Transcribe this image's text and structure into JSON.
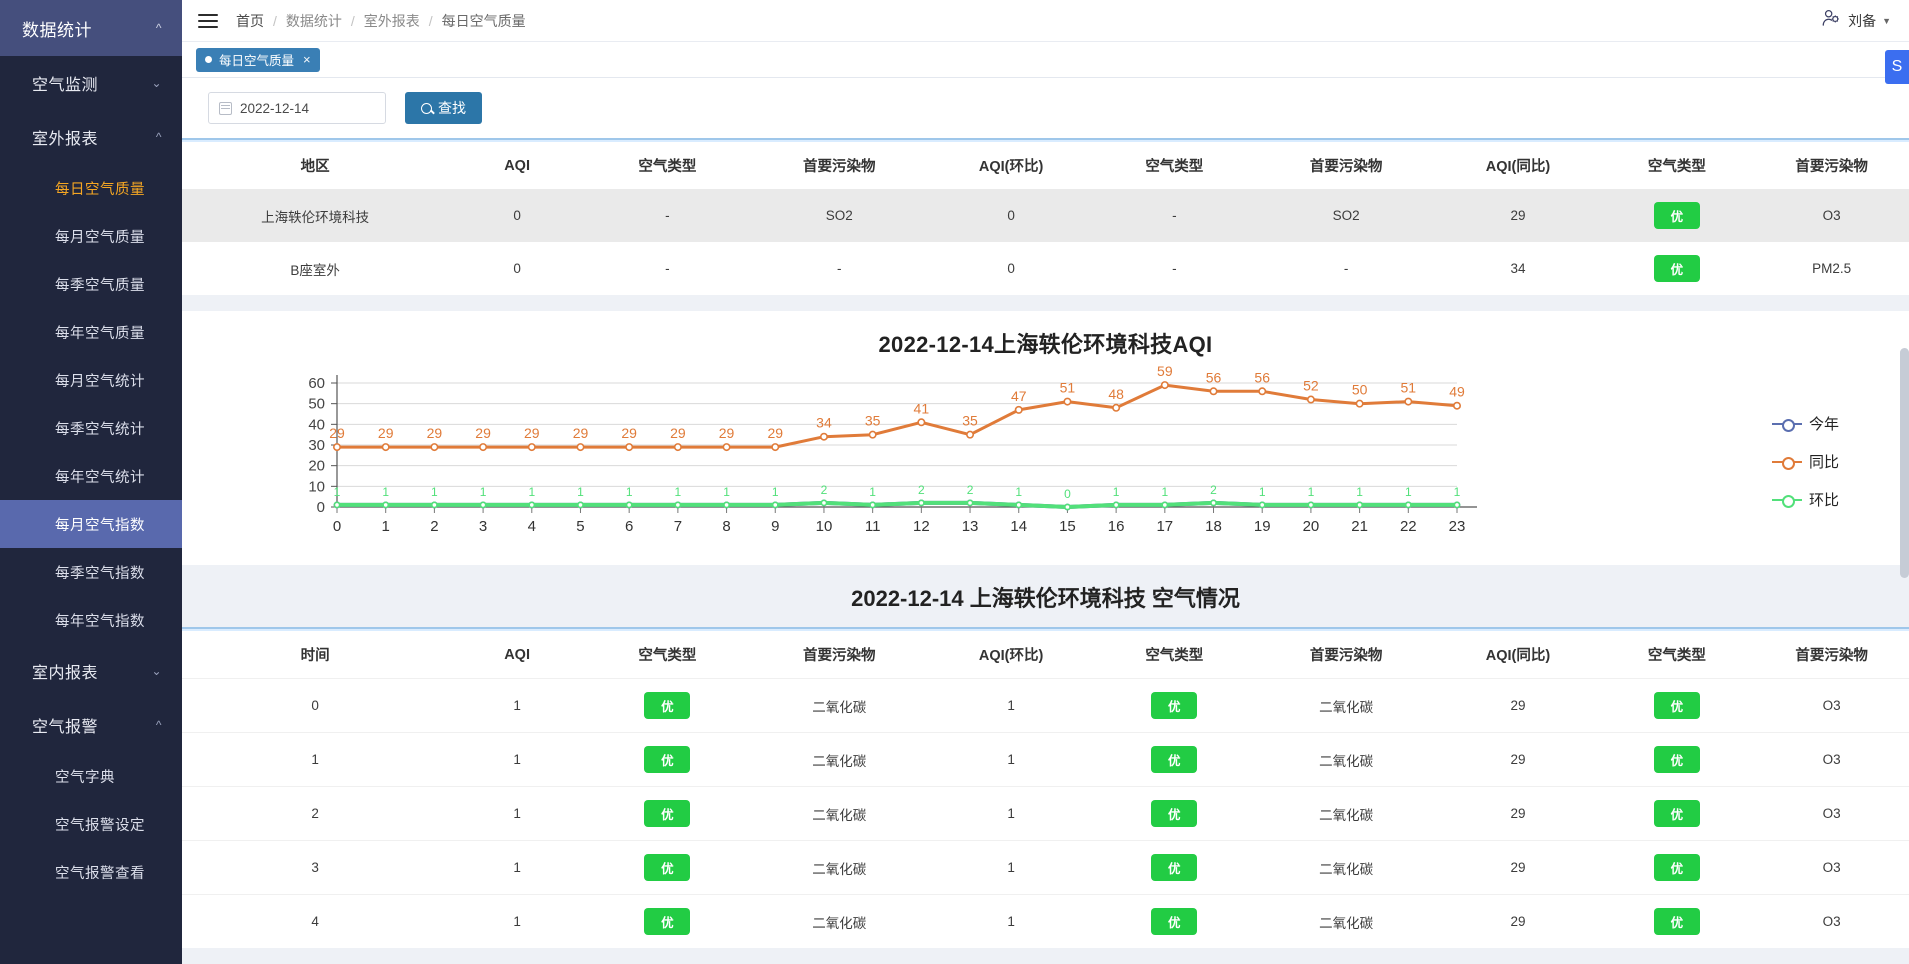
{
  "sidebar": {
    "root": {
      "label": "数据统计",
      "caret": "chevron-up"
    },
    "groups": [
      {
        "label": "空气监测",
        "caret": "chevron-down",
        "items": []
      },
      {
        "label": "室外报表",
        "caret": "chevron-up",
        "items": [
          {
            "label": "每日空气质量",
            "state": "active-text"
          },
          {
            "label": "每月空气质量",
            "state": ""
          },
          {
            "label": "每季空气质量",
            "state": ""
          },
          {
            "label": "每年空气质量",
            "state": ""
          },
          {
            "label": "每月空气统计",
            "state": ""
          },
          {
            "label": "每季空气统计",
            "state": ""
          },
          {
            "label": "每年空气统计",
            "state": ""
          },
          {
            "label": "每月空气指数",
            "state": "active-bg"
          },
          {
            "label": "每季空气指数",
            "state": ""
          },
          {
            "label": "每年空气指数",
            "state": ""
          }
        ]
      },
      {
        "label": "室内报表",
        "caret": "chevron-down",
        "items": []
      },
      {
        "label": "空气报警",
        "caret": "chevron-up",
        "items": [
          {
            "label": "空气字典",
            "state": ""
          },
          {
            "label": "空气报警设定",
            "state": ""
          },
          {
            "label": "空气报警查看",
            "state": ""
          }
        ]
      }
    ]
  },
  "topbar": {
    "menu_icon": "hamburger-icon",
    "breadcrumb": [
      "首页",
      "数据统计",
      "室外报表",
      "每日空气质量"
    ],
    "separator": "/",
    "user": {
      "icon": "user-gear-icon",
      "name": "刘备",
      "caret": "▼"
    }
  },
  "tabs": [
    {
      "label": "每日空气质量",
      "close": "×"
    }
  ],
  "search": {
    "date_value": "2022-12-14",
    "date_icon": "calendar-icon",
    "button_label": "查找",
    "button_icon": "search-icon"
  },
  "summary_table": {
    "headers": [
      "地区",
      "AQI",
      "空气类型",
      "首要污染物",
      "AQI(环比)",
      "空气类型",
      "首要污染物",
      "AQI(同比)",
      "空气类型",
      "首要污染物"
    ],
    "rows": [
      [
        "上海轶伦环境科技",
        "0",
        "-",
        "SO2",
        "0",
        "-",
        "SO2",
        "29",
        "优",
        "O3"
      ],
      [
        "B座室外",
        "0",
        "-",
        "-",
        "0",
        "-",
        "-",
        "34",
        "优",
        "PM2.5"
      ]
    ],
    "badge_columns": [
      8
    ]
  },
  "chart_data": {
    "type": "line",
    "title": "2022-12-14上海轶伦环境科技AQI",
    "xlabel": "",
    "ylabel": "",
    "ylim": [
      0,
      60
    ],
    "yticks": [
      0,
      10,
      20,
      30,
      40,
      50,
      60
    ],
    "grid": true,
    "legend_position": "right",
    "categories": [
      "0",
      "1",
      "2",
      "3",
      "4",
      "5",
      "6",
      "7",
      "8",
      "9",
      "10",
      "11",
      "12",
      "13",
      "14",
      "15",
      "16",
      "17",
      "18",
      "19",
      "20",
      "21",
      "22",
      "23"
    ],
    "series": [
      {
        "name": "今年",
        "color": "#5b6fb0",
        "values": [
          1,
          1,
          1,
          1,
          1,
          1,
          1,
          1,
          1,
          1,
          2,
          1,
          2,
          2,
          1,
          0,
          1,
          1,
          2,
          1,
          1,
          1,
          1,
          1
        ]
      },
      {
        "name": "同比",
        "color": "#e07b39",
        "values": [
          29,
          29,
          29,
          29,
          29,
          29,
          29,
          29,
          29,
          29,
          34,
          35,
          41,
          35,
          47,
          51,
          48,
          59,
          56,
          56,
          52,
          50,
          51,
          49
        ],
        "labels": [
          "29",
          "29",
          "29",
          "29",
          "29",
          "29",
          "29",
          "29",
          "29",
          "29",
          "34",
          "35",
          "41",
          "35",
          "47",
          "51",
          "48",
          "59",
          "56",
          "56",
          "52",
          "50",
          "51",
          "49"
        ]
      },
      {
        "name": "环比",
        "color": "#52e07a",
        "values": [
          1,
          1,
          1,
          1,
          1,
          1,
          1,
          1,
          1,
          1,
          2,
          1,
          2,
          2,
          1,
          0,
          1,
          1,
          2,
          1,
          1,
          1,
          1,
          1
        ],
        "labels": [
          "1",
          "1",
          "1",
          "1",
          "1",
          "1",
          "1",
          "1",
          "1",
          "1",
          "2",
          "1",
          "2",
          "2",
          "1",
          "0",
          "1",
          "1",
          "2",
          "1",
          "1",
          "1",
          "1",
          "1"
        ]
      }
    ]
  },
  "detail_section_title": "2022-12-14 上海轶伦环境科技 空气情况",
  "detail_table": {
    "headers": [
      "时间",
      "AQI",
      "空气类型",
      "首要污染物",
      "AQI(环比)",
      "空气类型",
      "首要污染物",
      "AQI(同比)",
      "空气类型",
      "首要污染物"
    ],
    "rows": [
      [
        "0",
        "1",
        "优",
        "二氧化碳",
        "1",
        "优",
        "二氧化碳",
        "29",
        "优",
        "O3"
      ],
      [
        "1",
        "1",
        "优",
        "二氧化碳",
        "1",
        "优",
        "二氧化碳",
        "29",
        "优",
        "O3"
      ],
      [
        "2",
        "1",
        "优",
        "二氧化碳",
        "1",
        "优",
        "二氧化碳",
        "29",
        "优",
        "O3"
      ],
      [
        "3",
        "1",
        "优",
        "二氧化碳",
        "1",
        "优",
        "二氧化碳",
        "29",
        "优",
        "O3"
      ],
      [
        "4",
        "1",
        "优",
        "二氧化碳",
        "1",
        "优",
        "二氧化碳",
        "29",
        "优",
        "O3"
      ]
    ],
    "badge_columns": [
      2,
      5,
      8
    ]
  },
  "colors": {
    "sidebar_bg": "#20263d",
    "sidebar_root": "#454f7d",
    "sidebar_active": "#5969ad",
    "sidebar_active_text": "#f5a623",
    "tab_bg": "#3a7fb5",
    "button_bg": "#2c76a8",
    "badge_green": "#22cc44",
    "series_today": "#5b6fb0",
    "series_yoy": "#e07b39",
    "series_mom": "#52e07a"
  },
  "float_button": {
    "icon": "s-logo-icon",
    "label": "S"
  }
}
